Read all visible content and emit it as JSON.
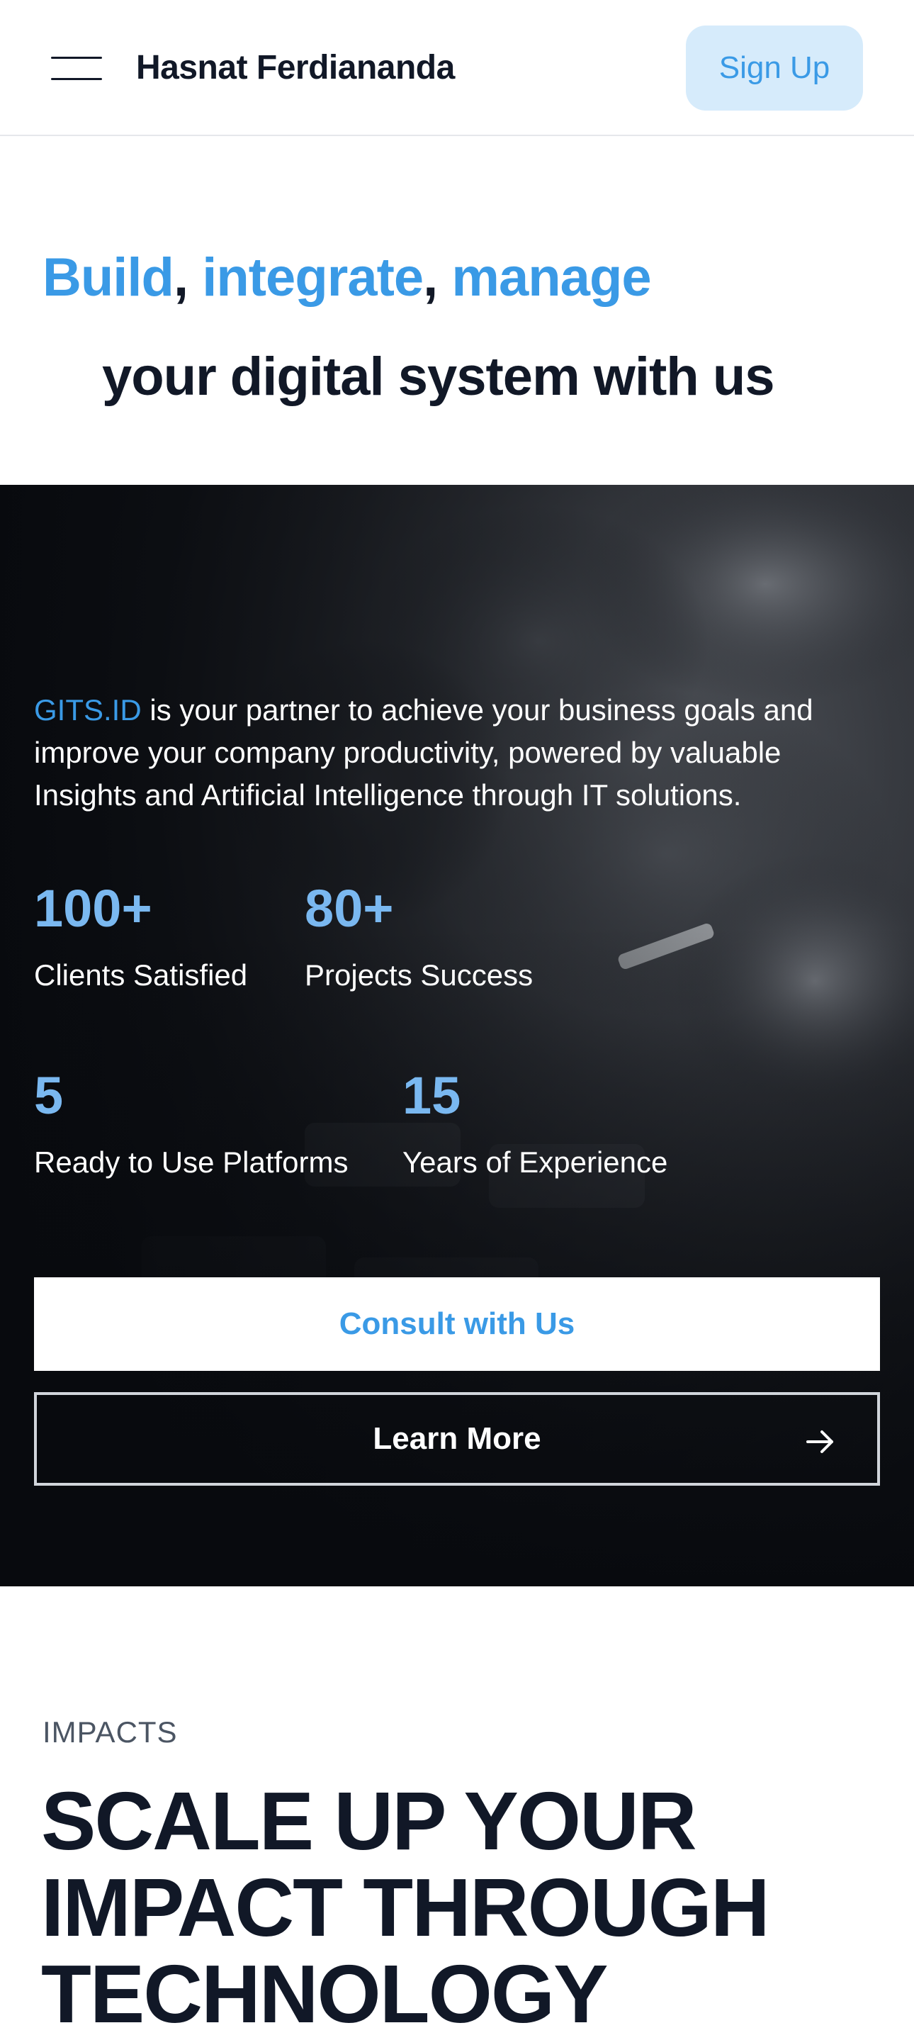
{
  "header": {
    "brand": "Hasnat Ferdiananda",
    "signup_label": "Sign Up"
  },
  "hero": {
    "kw1": "Build",
    "sep1": ", ",
    "kw2": "integrate",
    "sep2": ", ",
    "kw3": "manage",
    "line2": "your digital system with us"
  },
  "intro": {
    "brand": "GITS.ID",
    "text": " is your partner to achieve your business goals and improve your company productivity, powered by valuable Insights and Artificial Intelligence through IT solutions."
  },
  "stats": [
    {
      "value": "100+",
      "label": "Clients Satisfied"
    },
    {
      "value": "80+",
      "label": "Projects Success"
    },
    {
      "value": "5",
      "label": "Ready to Use Platforms"
    },
    {
      "value": "15",
      "label": "Years of Experience"
    }
  ],
  "cta": {
    "consult_label": "Consult with Us",
    "learn_label": "Learn More"
  },
  "impacts": {
    "label": "IMPACTS",
    "title": "SCALE UP YOUR IMPACT THROUGH TECHNOLOGY"
  },
  "colors": {
    "accent": "#3a9ae6",
    "stat_accent": "#7ab8f0",
    "signup_bg": "#d6ebfb",
    "dark_bg": "#0d0f13",
    "text_dark": "#111827"
  },
  "icons": {
    "menu": "hamburger-icon",
    "arrow": "arrow-right-icon"
  }
}
